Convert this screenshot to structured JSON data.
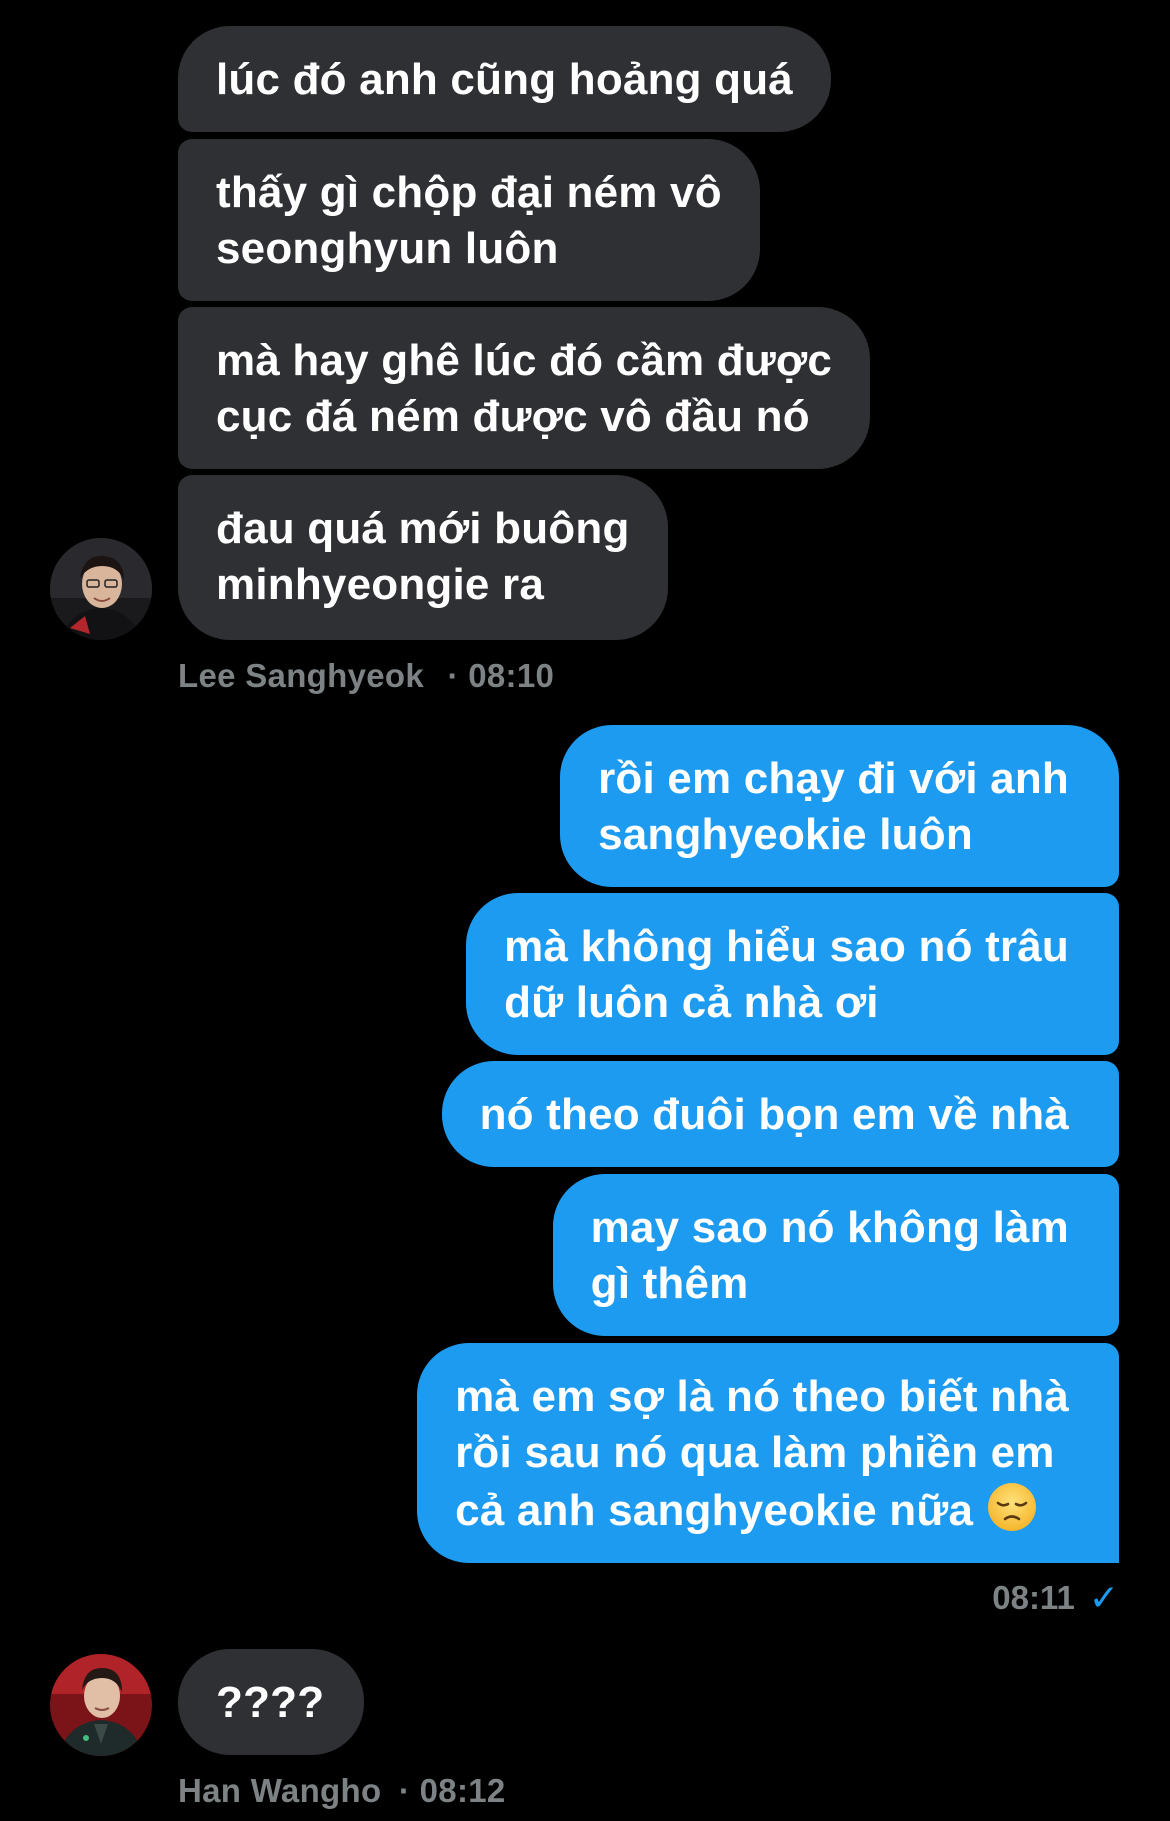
{
  "conversation": {
    "group1": {
      "messages": [
        "lúc đó anh cũng hoảng quá",
        "thấy gì chộp đại ném vô\nseonghyun luôn",
        "mà hay ghê lúc đó cầm được\ncục đá ném được vô đầu nó",
        "đau quá mới buông\nminhyeongie ra"
      ],
      "sender": "Lee Sanghyeok",
      "time": "· 08:10"
    },
    "group2": {
      "messages": [
        "rồi em chạy đi với anh\nsanghyeokie luôn",
        "mà không hiểu sao nó trâu\ndữ luôn cả nhà ơi",
        "nó theo đuôi bọn em về nhà",
        "may sao nó không làm\ngì thêm",
        "mà em sợ là nó theo biết nhà\nrồi sau nó qua làm phiền em\ncả anh sanghyeokie nữa"
      ],
      "time": "08:11",
      "read_icon": "checkmark-icon"
    },
    "group3": {
      "messages": [
        "????"
      ],
      "sender": "Han Wangho",
      "time": "· 08:12"
    }
  },
  "colors": {
    "background": "#000000",
    "received_bubble": "#2f3033",
    "sent_bubble": "#1d9bf0",
    "meta_text": "#7d8285"
  }
}
